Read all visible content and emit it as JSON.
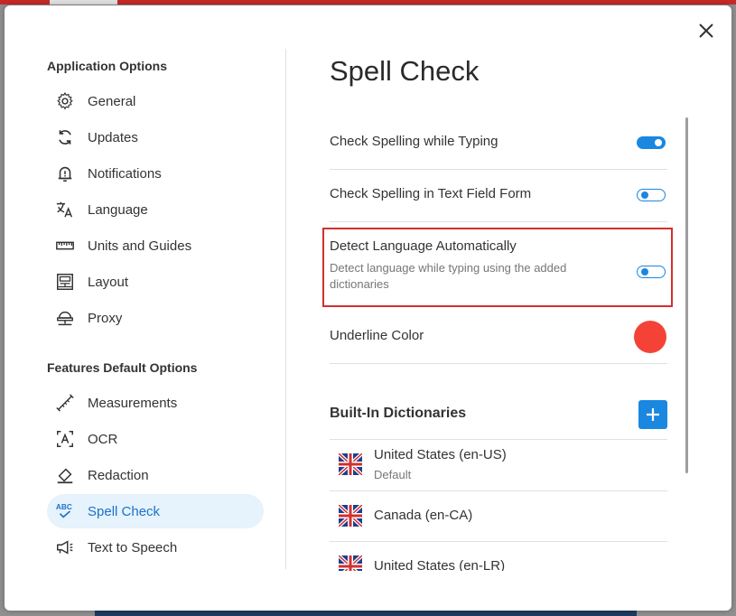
{
  "sidebar": {
    "section1_title": "Application Options",
    "section2_title": "Features Default Options",
    "items": [
      {
        "label": "General",
        "icon": "gear-icon"
      },
      {
        "label": "Updates",
        "icon": "refresh-icon"
      },
      {
        "label": "Notifications",
        "icon": "bell-icon"
      },
      {
        "label": "Language",
        "icon": "translate-icon"
      },
      {
        "label": "Units and Guides",
        "icon": "ruler-icon"
      },
      {
        "label": "Layout",
        "icon": "layout-icon"
      },
      {
        "label": "Proxy",
        "icon": "proxy-icon"
      },
      {
        "label": "Measurements",
        "icon": "measure-icon"
      },
      {
        "label": "OCR",
        "icon": "ocr-icon"
      },
      {
        "label": "Redaction",
        "icon": "eraser-icon"
      },
      {
        "label": "Spell Check",
        "icon": "spellcheck-icon",
        "active": true
      },
      {
        "label": "Text to Speech",
        "icon": "megaphone-icon"
      }
    ]
  },
  "main": {
    "title": "Spell Check",
    "settings": [
      {
        "label": "Check Spelling while Typing",
        "enabled": true
      },
      {
        "label": "Check Spelling in Text Field Form",
        "enabled": false
      },
      {
        "label": "Detect Language Automatically",
        "description": "Detect language while typing using the added dictionaries",
        "enabled": false
      },
      {
        "label": "Underline Color",
        "color": "#f44336"
      }
    ],
    "dictionaries": {
      "title": "Built-In Dictionaries",
      "items": [
        {
          "name": "United States (en-US)",
          "sub": "Default"
        },
        {
          "name": "Canada (en-CA)"
        },
        {
          "name": "United States (en-LR)"
        }
      ]
    }
  },
  "colors": {
    "accent": "#1a87e0",
    "active_bg": "#e6f2fc",
    "highlight": "#d32f2f",
    "underline": "#f44336"
  }
}
